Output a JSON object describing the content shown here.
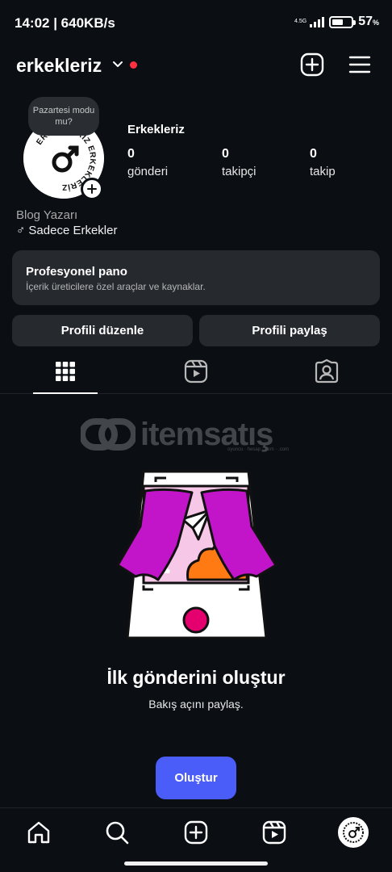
{
  "status_bar": {
    "time_speed": "14:02 | 640KB/s",
    "network": "4.5G",
    "battery_percent": "57",
    "battery_unit": "%",
    "battery_level": 0.57
  },
  "header": {
    "username": "erkekleriz",
    "add_icon": "plus-square-icon",
    "menu_icon": "hamburger-menu-icon"
  },
  "profile": {
    "note": "Pazartesi modu mu?",
    "avatar_logo_text": "ERKEKLERİZ ERKEKLERİZ",
    "display_name": "Erkekleriz",
    "stats": [
      {
        "count": "0",
        "label": "gönderi"
      },
      {
        "count": "0",
        "label": "takipçi"
      },
      {
        "count": "0",
        "label": "takip"
      }
    ],
    "bio_category": "Blog Yazarı",
    "bio_text": "♂ Sadece Erkekler"
  },
  "professional_dashboard": {
    "title": "Profesyonel pano",
    "subtitle": "İçerik üreticilere özel araçlar ve kaynaklar."
  },
  "actions": {
    "edit_profile": "Profili düzenle",
    "share_profile": "Profili paylaş"
  },
  "tabs": [
    {
      "icon": "grid-icon",
      "active": true
    },
    {
      "icon": "reels-icon",
      "active": false
    },
    {
      "icon": "tagged-icon",
      "active": false
    }
  ],
  "watermark": {
    "text": "itemsatış",
    "sub": "oyuncu · hesap · item · .com"
  },
  "empty_state": {
    "title": "İlk gönderini oluştur",
    "subtitle": "Bakış açını paylaş.",
    "button": "Oluştur"
  },
  "colors": {
    "background": "#0b0f14",
    "card": "#262a2f",
    "accent": "#4a5df9",
    "notification": "#ff3040",
    "curtain": "#c215c9",
    "cloud": "#ff7a12"
  },
  "bottom_nav": [
    {
      "icon": "home-icon"
    },
    {
      "icon": "search-icon"
    },
    {
      "icon": "create-icon"
    },
    {
      "icon": "reels-icon"
    },
    {
      "icon": "profile-avatar-icon"
    }
  ]
}
